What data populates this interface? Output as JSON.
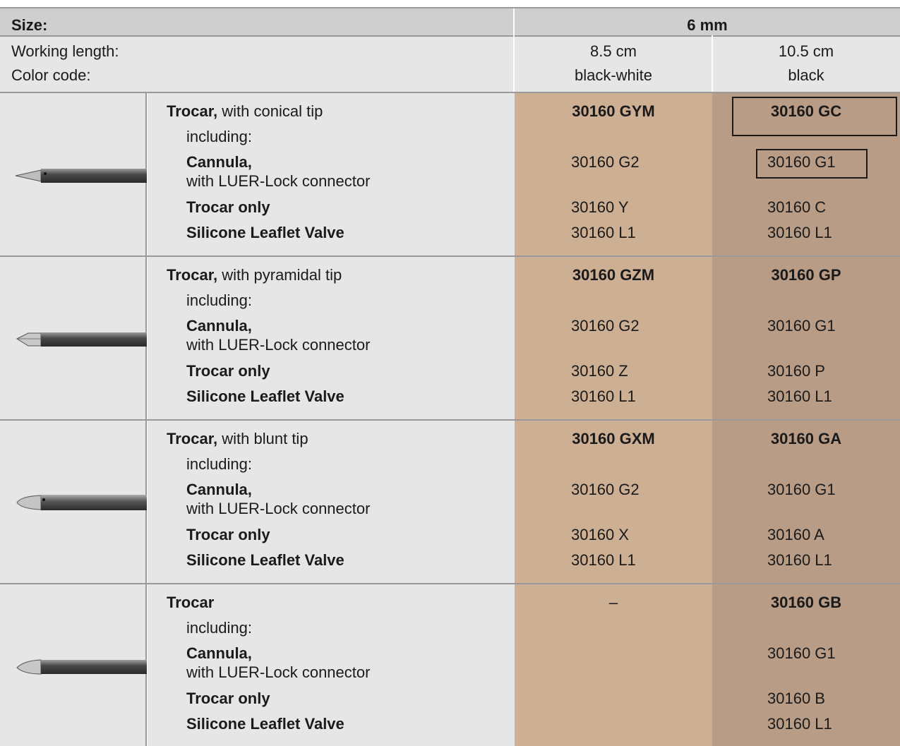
{
  "header": {
    "size_label": "Size:",
    "size_value": "6 mm",
    "working_length_label": "Working length:",
    "color_code_label": "Color code:",
    "columns": [
      {
        "length": "8.5 cm",
        "color": "black-white"
      },
      {
        "length": "10.5 cm",
        "color": "black"
      }
    ]
  },
  "labels": {
    "including": "including:",
    "cannula": "Cannula,",
    "luer": "with LUER-Lock connector",
    "trocar_only": "Trocar only",
    "valve": "Silicone Leaflet Valve"
  },
  "rows": [
    {
      "title_bold": "Trocar,",
      "title_rest": " with conical tip",
      "icon": "trocar-conical-tip-icon",
      "c1": {
        "set": "30160 GYM",
        "cannula": "30160 G2",
        "trocar": "30160 Y",
        "valve": "30160 L1"
      },
      "c2": {
        "set": "30160 GC",
        "cannula": "30160 G1",
        "trocar": "30160 C",
        "valve": "30160 L1"
      }
    },
    {
      "title_bold": "Trocar,",
      "title_rest": " with pyramidal tip",
      "icon": "trocar-pyramidal-tip-icon",
      "c1": {
        "set": "30160 GZM",
        "cannula": "30160 G2",
        "trocar": "30160 Z",
        "valve": "30160 L1"
      },
      "c2": {
        "set": "30160 GP",
        "cannula": "30160 G1",
        "trocar": "30160 P",
        "valve": "30160 L1"
      }
    },
    {
      "title_bold": "Trocar,",
      "title_rest": " with blunt tip",
      "icon": "trocar-blunt-tip-icon",
      "c1": {
        "set": "30160 GXM",
        "cannula": "30160 G2",
        "trocar": "30160 X",
        "valve": "30160 L1"
      },
      "c2": {
        "set": "30160 GA",
        "cannula": "30160 G1",
        "trocar": "30160 A",
        "valve": "30160 L1"
      }
    },
    {
      "title_bold": "Trocar",
      "title_rest": "",
      "icon": "trocar-tip-icon",
      "c1": {
        "set": "–",
        "cannula": "",
        "trocar": "",
        "valve": ""
      },
      "c2": {
        "set": "30160 GB",
        "cannula": "30160 G1",
        "trocar": "30160 B",
        "valve": "30160 L1"
      }
    }
  ],
  "colors": {
    "header_dark": "#cfcfcf",
    "header_light": "#e6e6e6",
    "col_8_5": "#cdaf93",
    "col_10_5": "#b89c85"
  }
}
